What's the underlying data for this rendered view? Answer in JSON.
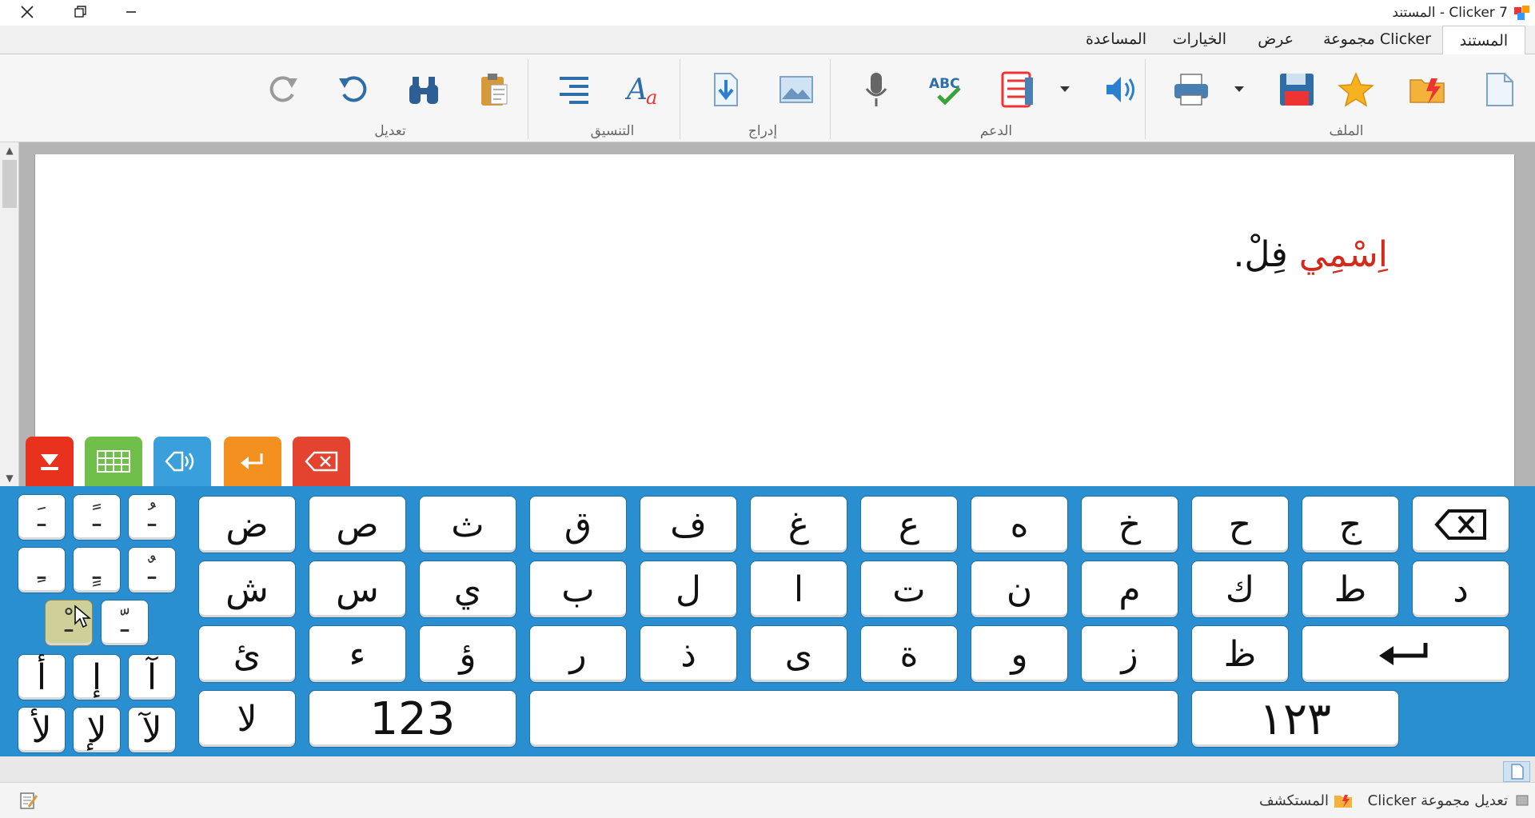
{
  "window": {
    "title": "Clicker 7 - المستند"
  },
  "menu": {
    "items": [
      "المستند",
      "مجموعة Clicker",
      "عرض",
      "الخيارات",
      "المساعدة"
    ]
  },
  "ribbon": {
    "groups": [
      "الملف",
      "الدعم",
      "إدراج",
      "التنسيق",
      "تعديل"
    ]
  },
  "document": {
    "word_highlighted": "اِسْمِي",
    "word_name": "فِلْ."
  },
  "keyboard": {
    "row1": [
      "ج",
      "ح",
      "خ",
      "ه",
      "ع",
      "غ",
      "ف",
      "ق",
      "ث",
      "ص",
      "ض"
    ],
    "row2": [
      "د",
      "ط",
      "ك",
      "م",
      "ن",
      "ت",
      "ا",
      "ل",
      "ب",
      "ي",
      "س",
      "ش"
    ],
    "row3": [
      "ظ",
      "ز",
      "و",
      "ة",
      "ى",
      "ذ",
      "ر",
      "ؤ",
      "ء",
      "ئ"
    ],
    "row4_left_lam_alef": "لا",
    "latin_numbers": "123",
    "arabic_numbers": "١٢٣",
    "diacritics_row1": [
      "ـَ",
      "ـً",
      "ـُ"
    ],
    "diacritics_row2": [
      "ـِ",
      "ـٍ",
      "ـٌ"
    ],
    "diacritics_row3": [
      "ـْ",
      "ـّ"
    ],
    "hamza_row1": [
      "أ",
      "إ",
      "آ"
    ],
    "hamza_row2": [
      "لأ",
      "لإ",
      "لآ"
    ]
  },
  "statusbar": {
    "explorer": "المستكشف",
    "edit_set": "تعديل مجموعة Clicker"
  },
  "colors": {
    "keyboard_bg": "#2a8fd0",
    "highlight_word": "#d42a1c",
    "btn_red": "#e8321e",
    "btn_green": "#6fbf4a",
    "btn_blue": "#3aa0dc",
    "btn_orange": "#f39020",
    "btn_red2": "#e4432f"
  }
}
